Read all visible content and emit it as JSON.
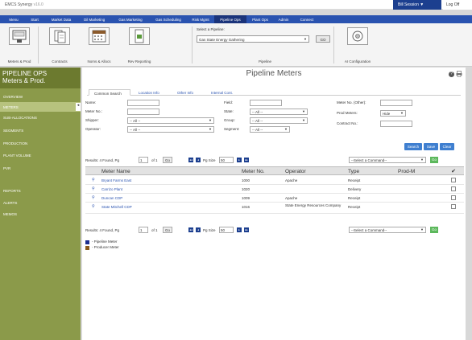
{
  "app": {
    "title": "EMCS Synergy",
    "version": "v16.0"
  },
  "session": {
    "label": "Bill Session ▼",
    "logoff": "Log Off"
  },
  "nav": {
    "items": [
      "Menu",
      "Start",
      "Market Data",
      "Oil Marketing",
      "Gas Marketing",
      "Gas Scheduling",
      "Risk Mgmt",
      "Pipeline Ops",
      "Plant Ops",
      "Admin",
      "Connect"
    ],
    "active": "Pipeline Ops"
  },
  "ribbon": {
    "buttons": [
      {
        "label": "Meters & Prod",
        "icon": "meter-icon"
      },
      {
        "label": "Contracts",
        "icon": "contract-icon"
      },
      {
        "label": "Noms & Allocs",
        "icon": "calendar-icon"
      },
      {
        "label": "Rev Reporting",
        "icon": "report-icon"
      },
      {
        "label": "AI Configuration",
        "icon": "config-icon"
      }
    ],
    "pipeline_caption": "Select a Pipeline:",
    "pipeline_value": "Gas State Energy Gathering",
    "go_label": "GO",
    "group_label": "Pipeline"
  },
  "sidebar": {
    "title_line1": "PIPELINE OPS",
    "title_line2": "Meters & Prod.",
    "items": [
      "OVERVIEW",
      "METERS",
      "SUB-ALLOCATIONS",
      "SEGMENTS",
      "PRODUCTION",
      "PLANT VOLUME",
      "PVR"
    ],
    "items2": [
      "REPORTS",
      "ALERTS",
      "MEMOS"
    ],
    "active": "METERS",
    "collapse_glyph": "◂"
  },
  "main": {
    "title": "Pipeline Meters",
    "help_glyph": "?",
    "tabs": [
      "Common Search",
      "Location Info",
      "Other Info",
      "Internal Cont."
    ],
    "active_tab": "Common Search"
  },
  "search": {
    "name_label": "Name:",
    "meter_no_label": "Meter No.:",
    "shipper_label": "Shipper:",
    "operator_label": "Operator:",
    "field_label": "Field:",
    "state_label": "State:",
    "group_label": "Group:",
    "segment_label": "Segment:",
    "meter_no_other_label": "Meter No. (Other):",
    "prod_meters_label": "Prod Meters:",
    "contract_no_label": "Contract No.:",
    "all_option": "-- All --",
    "hide_option": "Hide",
    "buttons": {
      "search": "Search",
      "save": "Save",
      "clear": "Clear"
    }
  },
  "results": {
    "found_text": "Results: 4 Found, Pg",
    "page": "1",
    "of_text": "of 1",
    "go": "Go",
    "page_size_label": "Pg Size",
    "page_size": "50",
    "command_placeholder": "--Select a Command--",
    "go_green": "Go",
    "nav_glyphs": [
      "◂◂",
      "◂",
      "▸",
      "▸▸"
    ]
  },
  "table": {
    "headers": {
      "name": "Meter Name",
      "no": "Meter No.",
      "operator": "Operator",
      "type": "Type",
      "prod": "Prod-M"
    },
    "rows": [
      {
        "name": "Bryant Farms East",
        "no": "1000",
        "operator": "Apache",
        "type": "Receipt"
      },
      {
        "name": "Carrizo Plant",
        "no": "1020",
        "operator": "",
        "type": "Delivery"
      },
      {
        "name": "Duncan CDP",
        "no": "1009",
        "operator": "Apache",
        "type": "Receipt"
      },
      {
        "name": "State Mitchell CDP",
        "no": "1016",
        "operator": "State Energy Resources Company",
        "type": "Receipt"
      }
    ]
  },
  "legend": {
    "items": [
      {
        "label": "- Pipeline Meter",
        "color": "#1c2f8f"
      },
      {
        "label": "- Producer Meter",
        "color": "#8a5a1a"
      }
    ]
  }
}
